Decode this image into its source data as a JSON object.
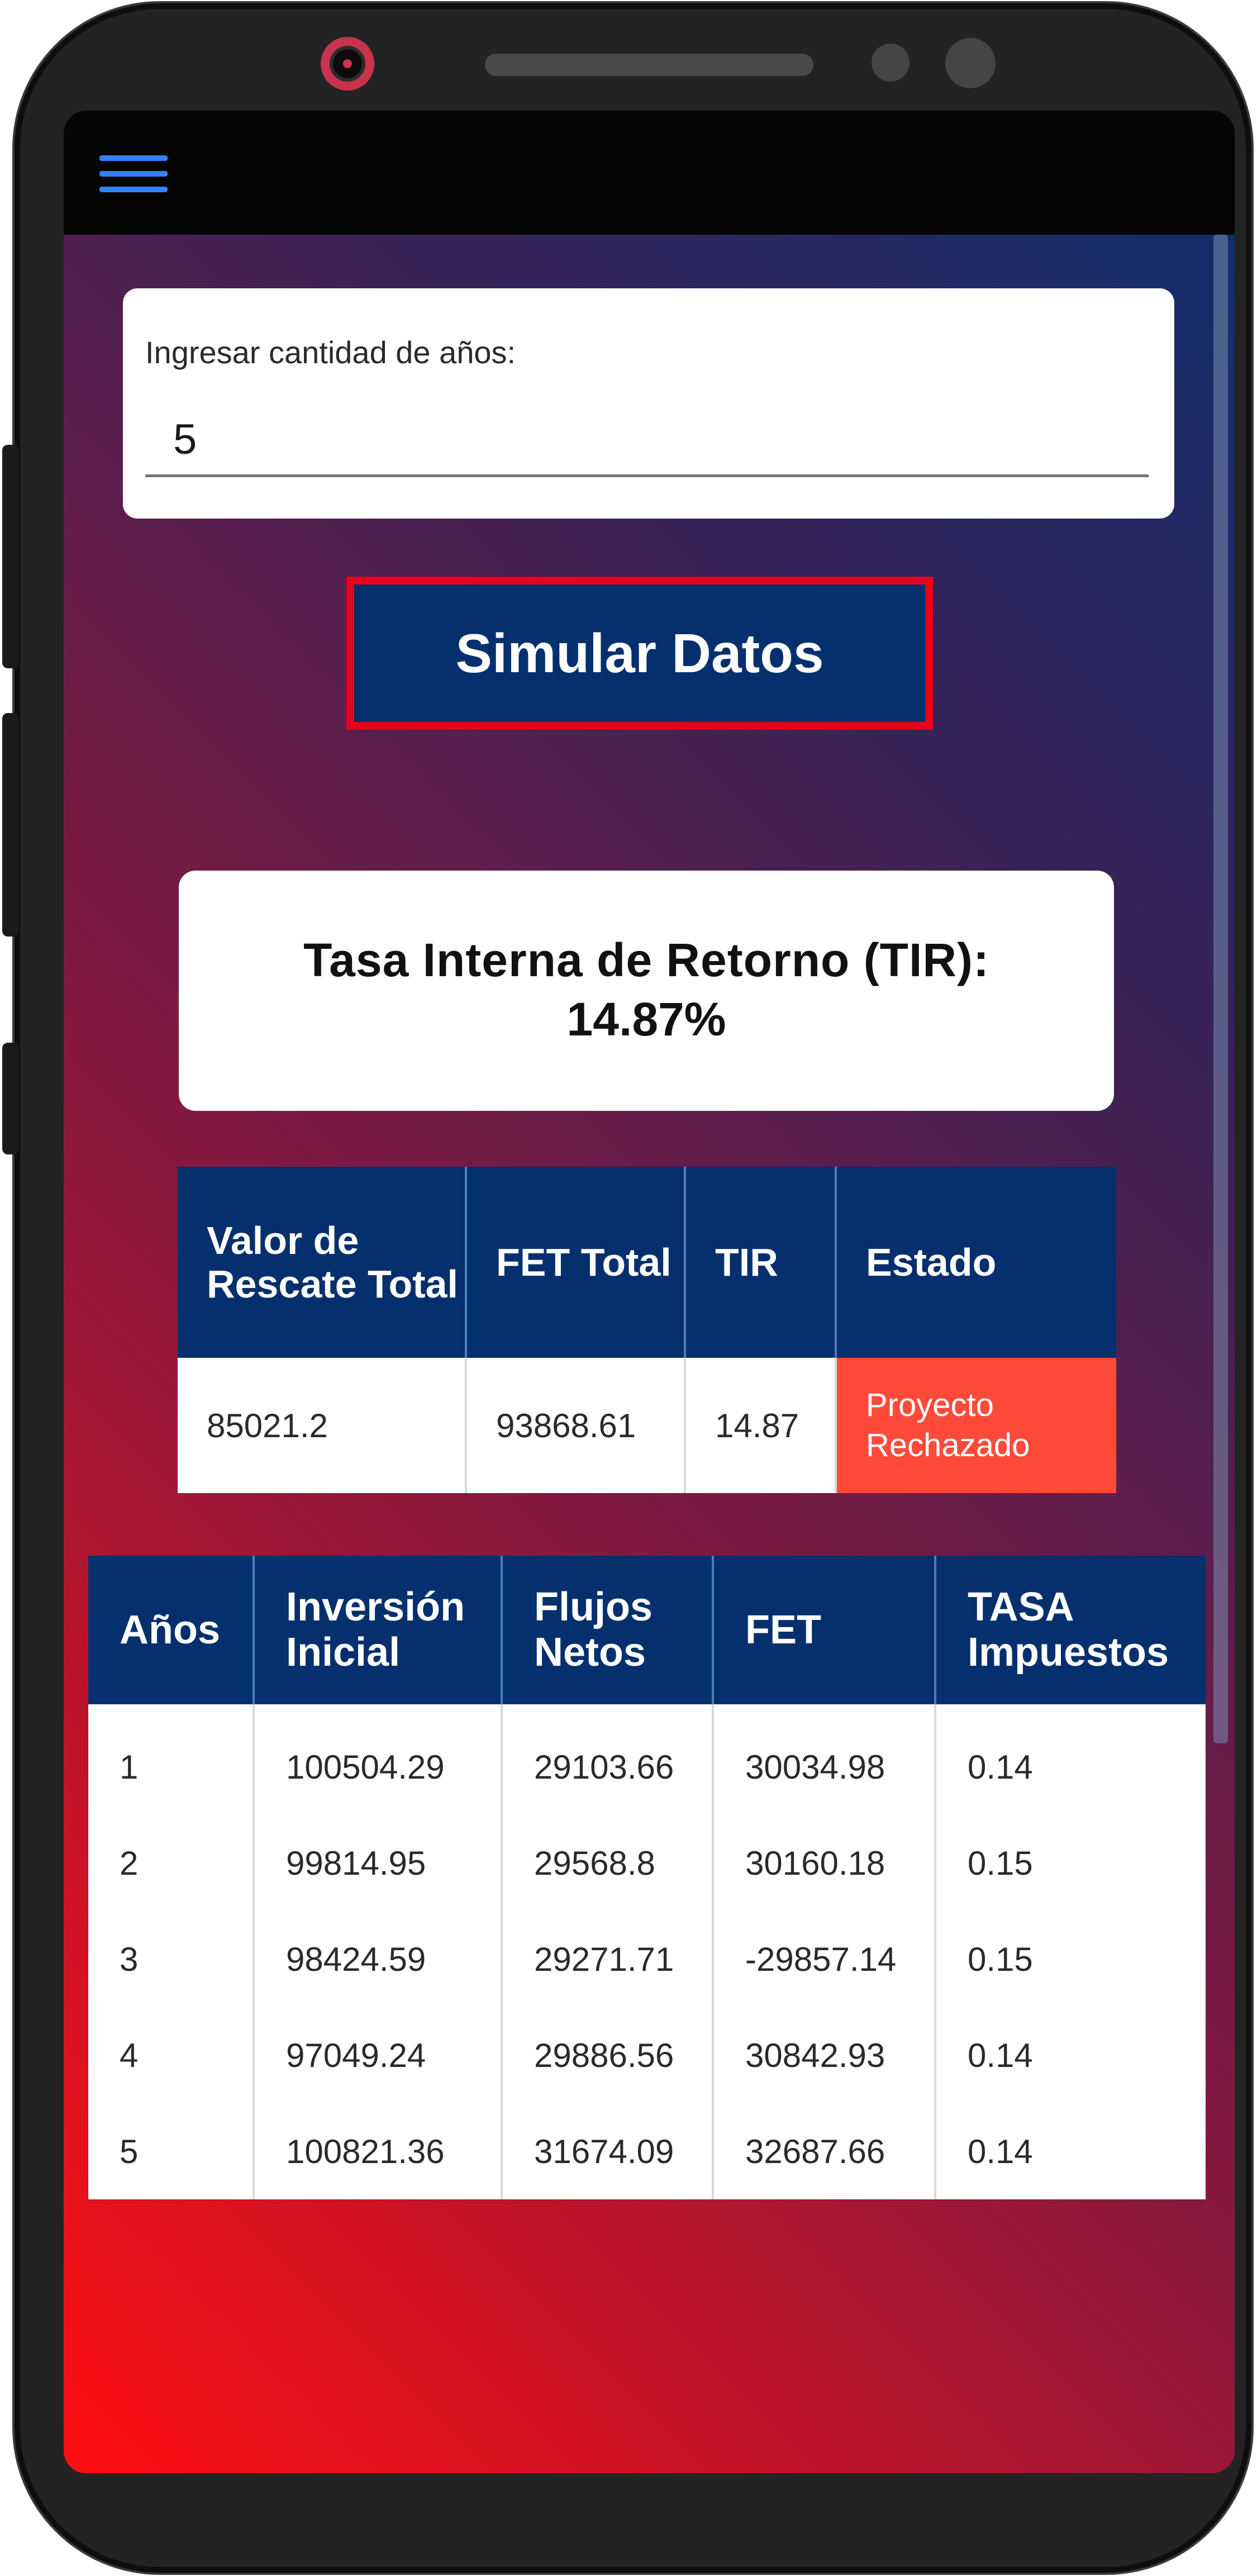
{
  "input": {
    "label": "Ingresar cantidad de años:",
    "value": "5"
  },
  "button": {
    "label": "Simular Datos"
  },
  "tir_card": {
    "label": "Tasa Interna de Retorno (TIR):",
    "value": "14.87%"
  },
  "summary_table": {
    "headers": [
      "Valor de Rescate Total",
      "FET Total",
      "TIR",
      "Estado"
    ],
    "row": [
      "85021.2",
      "93868.61",
      "14.87",
      "Proyecto Rechazado"
    ],
    "status_color": "#ff4a3a"
  },
  "years_table": {
    "headers": [
      "Años",
      "Inversión Inicial",
      "Flujos Netos",
      "FET",
      "TASA Impuestos"
    ],
    "rows": [
      [
        "1",
        "100504.29",
        "29103.66",
        "30034.98",
        "0.14"
      ],
      [
        "2",
        "99814.95",
        "29568.8",
        "30160.18",
        "0.15"
      ],
      [
        "3",
        "98424.59",
        "29271.71",
        "-29857.14",
        "0.15"
      ],
      [
        "4",
        "97049.24",
        "29886.56",
        "30842.93",
        "0.14"
      ],
      [
        "5",
        "100821.36",
        "31674.09",
        "32687.66",
        "0.14"
      ]
    ]
  },
  "colors": {
    "header_bg": "#06306d",
    "accent_blue": "#2f83ff",
    "highlight_border": "#e8001d"
  },
  "icons": {
    "menu": "hamburger-menu-icon"
  }
}
